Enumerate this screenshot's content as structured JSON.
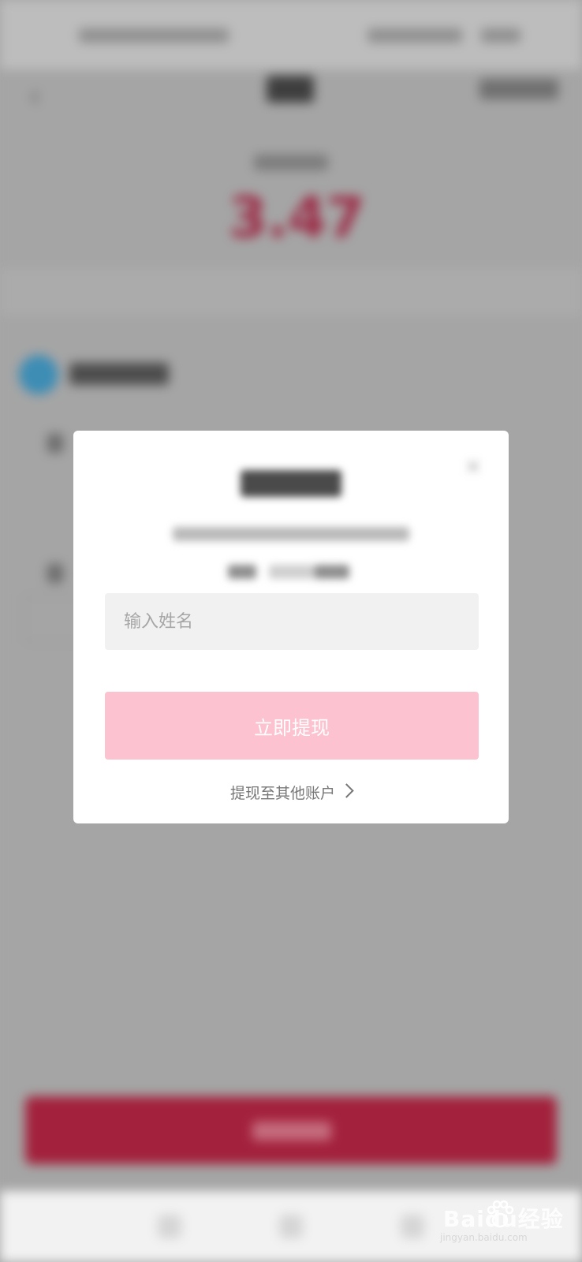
{
  "background": {
    "balance_value": "3.47",
    "colors": {
      "overlay": "#a6a6a6",
      "accent": "#a3213c",
      "channel_icon": "#3d8db5"
    }
  },
  "dialog": {
    "name_input": {
      "value": "",
      "placeholder": "输入姓名"
    },
    "withdraw_button_label": "立即提现",
    "other_account_link": "提现至其他账户",
    "close_icon": "close-icon",
    "colors": {
      "button_bg": "#fdc2cf",
      "input_bg": "#f1f1f1"
    }
  },
  "watermark": {
    "main": "Baidu经验",
    "sub": "jingyan.baidu.com"
  }
}
